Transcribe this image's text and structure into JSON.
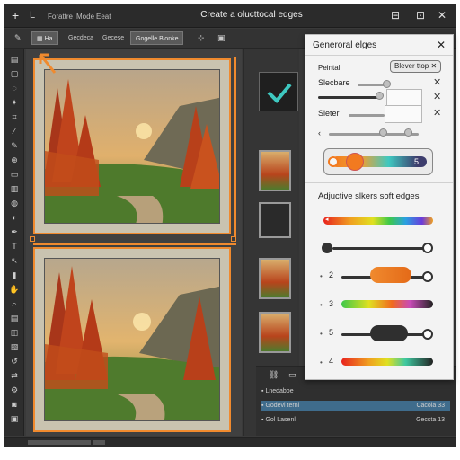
{
  "titlebar": {
    "menu": [
      "Forattre",
      "Mode",
      "Eeat"
    ],
    "title": "Create a olucttocal edges"
  },
  "toolbar": {
    "icon_label": "Ha",
    "tab1": "Gecdeca",
    "tab2": "Gecese",
    "active_tab": "Gogelle Blonke"
  },
  "panel": {
    "title": "Generoral elges",
    "section_label": "Peintal",
    "pill_label": "Blever ttop",
    "row1_label": "Slecbare",
    "row2_label": "Sleter",
    "hue_value": "5",
    "adjust_label": "Adjuctive slkers soft edges",
    "sliders": [
      {
        "num": "2"
      },
      {
        "num": "3"
      },
      {
        "num": "5"
      },
      {
        "num": "4"
      }
    ]
  },
  "layers": {
    "rows": [
      {
        "name": "Lnedaboe",
        "value": ""
      },
      {
        "name": "Godevi ternl",
        "value": "Cacoia 33"
      },
      {
        "name": "Gol Lasenl",
        "value": "Gecsta 13"
      }
    ]
  },
  "colors": {
    "accent_orange": "#f08a2e",
    "check_teal": "#3ec8c0"
  }
}
